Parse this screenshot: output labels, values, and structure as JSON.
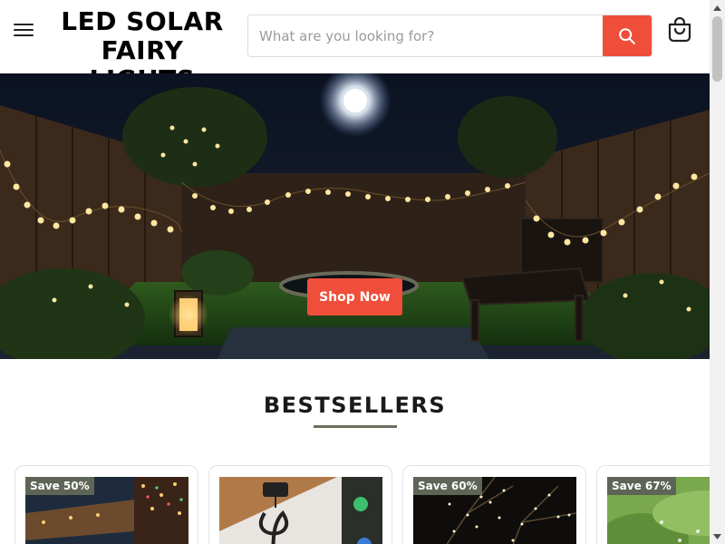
{
  "header": {
    "logo_line1": "LED SOLAR",
    "logo_line2": "FAIRY LIGHTS",
    "search_placeholder": "What are you looking for?",
    "menu_icon": "hamburger-icon",
    "search_icon": "search-icon",
    "cart_icon": "shopping-bag-icon"
  },
  "hero": {
    "button_label": "Shop Now"
  },
  "bestsellers": {
    "title": "BESTSELLERS",
    "products": [
      {
        "badge": "Save 50%"
      },
      {
        "badge": ""
      },
      {
        "badge": "Save 60%"
      },
      {
        "badge": "Save 67%"
      }
    ]
  },
  "colors": {
    "accent": "#ef4e3a",
    "badge": "#5f6556",
    "underline": "#6b6f5c"
  }
}
